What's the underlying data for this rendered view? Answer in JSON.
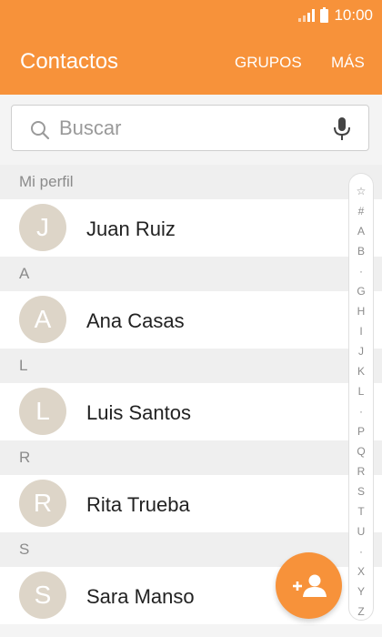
{
  "status_bar": {
    "time": "10:00"
  },
  "appbar": {
    "title": "Contactos",
    "actions": [
      "GRUPOS",
      "MÁS"
    ]
  },
  "search": {
    "placeholder": "Buscar"
  },
  "sections": [
    {
      "header": "Mi perfil",
      "contacts": [
        {
          "initial": "J",
          "name": "Juan Ruiz"
        }
      ]
    },
    {
      "header": "A",
      "contacts": [
        {
          "initial": "A",
          "name": "Ana Casas"
        }
      ]
    },
    {
      "header": "L",
      "contacts": [
        {
          "initial": "L",
          "name": "Luis Santos"
        }
      ]
    },
    {
      "header": "R",
      "contacts": [
        {
          "initial": "R",
          "name": "Rita Trueba"
        }
      ]
    },
    {
      "header": "S",
      "contacts": [
        {
          "initial": "S",
          "name": "Sara Manso"
        }
      ]
    }
  ],
  "index_bar": [
    "☆",
    "#",
    "A",
    "B",
    "·",
    "G",
    "H",
    "I",
    "J",
    "K",
    "L",
    "·",
    "P",
    "Q",
    "R",
    "S",
    "T",
    "U",
    "·",
    "X",
    "Y",
    "Z"
  ],
  "colors": {
    "accent": "#f7923a",
    "avatar_bg": "#ddd5c8"
  },
  "icons": {
    "search": "search-icon",
    "mic": "mic-icon",
    "fab": "add-contact-icon"
  }
}
